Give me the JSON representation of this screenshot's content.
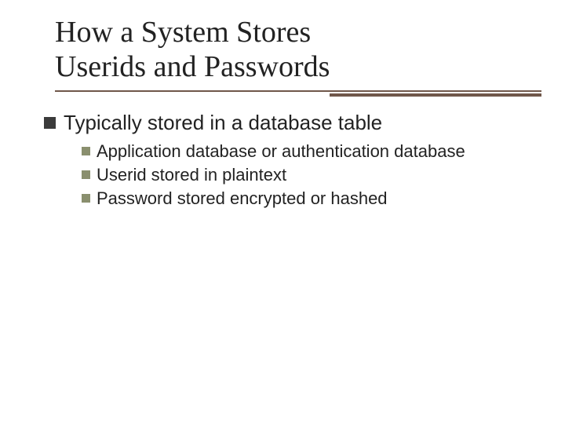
{
  "title_line1": "How a System Stores",
  "title_line2": "Userids and Passwords",
  "bullets": {
    "main": "Typically stored in a database table",
    "subs": [
      "Application database or authentication database",
      "Userid stored in plaintext",
      "Password stored encrypted or hashed"
    ]
  },
  "colors": {
    "underline": "#70574a",
    "sub_bullet": "#8a8f6e"
  }
}
